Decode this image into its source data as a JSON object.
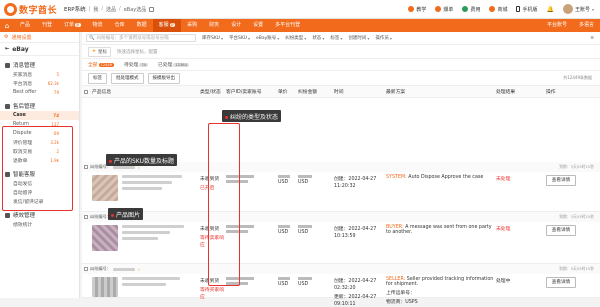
{
  "topbar": {
    "logo_text": "数字酋长",
    "breadcrumb": [
      "ERP系统",
      "我",
      "选品",
      "eBay选品"
    ],
    "right_items": [
      {
        "icon": "teach-icon",
        "label": "教学",
        "color": "#f26b1d"
      },
      {
        "icon": "explode-icon",
        "label": "爆单",
        "color": "#f26b1d"
      },
      {
        "icon": "fee-icon",
        "label": "费用",
        "color": "#2a9d5c"
      },
      {
        "icon": "mall-icon",
        "label": "商城",
        "color": "#f26b1d"
      },
      {
        "icon": "mobile-icon",
        "label": "手机版",
        "color": "#333"
      },
      {
        "icon": "bell-icon",
        "label": "",
        "color": "#333"
      },
      {
        "icon": "avatar",
        "label": "王账号",
        "color": "#333"
      }
    ]
  },
  "navbar": {
    "items": [
      {
        "label": "产品"
      },
      {
        "label": "刊登"
      },
      {
        "label": "订单",
        "badge": "新"
      },
      {
        "label": "物流"
      },
      {
        "label": "仓库"
      },
      {
        "label": "数据"
      },
      {
        "label": "客服",
        "badge": "新",
        "active": true
      },
      {
        "label": "采购"
      },
      {
        "label": "财务"
      },
      {
        "label": "设计"
      },
      {
        "label": "设置"
      },
      {
        "label": "多平台刊登"
      }
    ],
    "right_items": [
      {
        "label": "平台账号"
      },
      {
        "label": "多语言"
      }
    ]
  },
  "sidebar": {
    "common_settings": "通用设置",
    "platform": "eBay",
    "groups": [
      {
        "title": "消息管理",
        "items": [
          {
            "label": "买家消息",
            "count": "5"
          },
          {
            "label": "平台消息",
            "count": "62.3k"
          },
          {
            "label": "Best offer",
            "count": "79"
          }
        ]
      },
      {
        "title": "售后管理",
        "items": [
          {
            "label": "Case",
            "count": "74",
            "active": true
          },
          {
            "label": "Return",
            "count": "137"
          },
          {
            "label": "Dispute",
            "count": "69"
          },
          {
            "label": "评价管理",
            "count": "3.2k"
          },
          {
            "label": "取消交易",
            "count": "2"
          },
          {
            "label": "退款单",
            "count": "1.9k"
          }
        ]
      },
      {
        "title": "智能客服",
        "items": [
          {
            "label": "自动发信",
            "count": ""
          },
          {
            "label": "自动留评",
            "count": ""
          },
          {
            "label": "发信/留评记录",
            "count": ""
          }
        ]
      },
      {
        "title": "绩效管理",
        "items": [
          {
            "label": "绩效统计",
            "count": ""
          }
        ]
      }
    ]
  },
  "filters": {
    "search_placeholder": "纠纷编号：多个请用逗号或逗号分隔",
    "dropdowns": [
      "库存SKU",
      "平台SKU",
      "eBay账号",
      "纠纷类型",
      "状态",
      "标签",
      "创建时间",
      "操作员"
    ]
  },
  "star_row": {
    "button": "星标",
    "hint": "快速选择星标，配置"
  },
  "tabs": [
    {
      "label": "全部",
      "count": "12449",
      "active": true
    },
    {
      "label": "待处理",
      "count": "74"
    },
    {
      "label": "已处理",
      "count": "12384"
    }
  ],
  "actions": {
    "buttons": [
      "标签",
      "批处理模式",
      "按模板导出"
    ],
    "total": "共12449条数据"
  },
  "table": {
    "headers": [
      "产品信息",
      "类型/状态",
      "客户ID/卖家账号",
      "单价",
      "纠纷金额",
      "时间",
      "最新方案",
      "处理结果",
      "操作"
    ],
    "rows": [
      {
        "case_no_label": "纠纷编号：",
        "row_time": "到期：3天03时15秒",
        "type": "未收到货",
        "status": "已开启",
        "currency": "USD",
        "amount_currency": "USD",
        "created": "创建：2022-04-27",
        "created_time": "11:20:32",
        "latest_key": "SYSTEM:",
        "latest_text": "Auto Dispose Approve the case",
        "result": "未处理",
        "op_label": "查看详情"
      },
      {
        "case_no_label": "纠纷编号：",
        "row_time": "到期：3天03时15秒",
        "type": "未收到货",
        "status": "等待卖家响应",
        "currency": "USD",
        "amount_currency": "USD",
        "created": "创建：2022-04-27",
        "created_time": "10:13:59",
        "latest_key": "BUYER:",
        "latest_text": "A message was sent from one party to another.",
        "result": "未处理",
        "op_label": "查看详情"
      },
      {
        "case_no_label": "纠纷编号：",
        "row_time": "到期：3天03时15秒",
        "type": "未收到货",
        "status": "等待买家响应",
        "currency": "USD",
        "amount_currency": "USD",
        "created": "创建：2022-04-27",
        "created_time": "02:32:20",
        "created2": "更新：2022-04-27",
        "created2_time": "09:10:11",
        "latest_key": "SELLER:",
        "latest_text": "Seller provided tracking information for shipment.",
        "latest_extra": "上传运单号：",
        "latest_extra2": "物流商：USPS",
        "result": "处理中",
        "op_label": "查看详情"
      }
    ]
  },
  "callouts": {
    "type_status": "纠纷的类型及状态",
    "sku_title": "产品的SKU数量及标题",
    "product_image": "产品图片"
  }
}
